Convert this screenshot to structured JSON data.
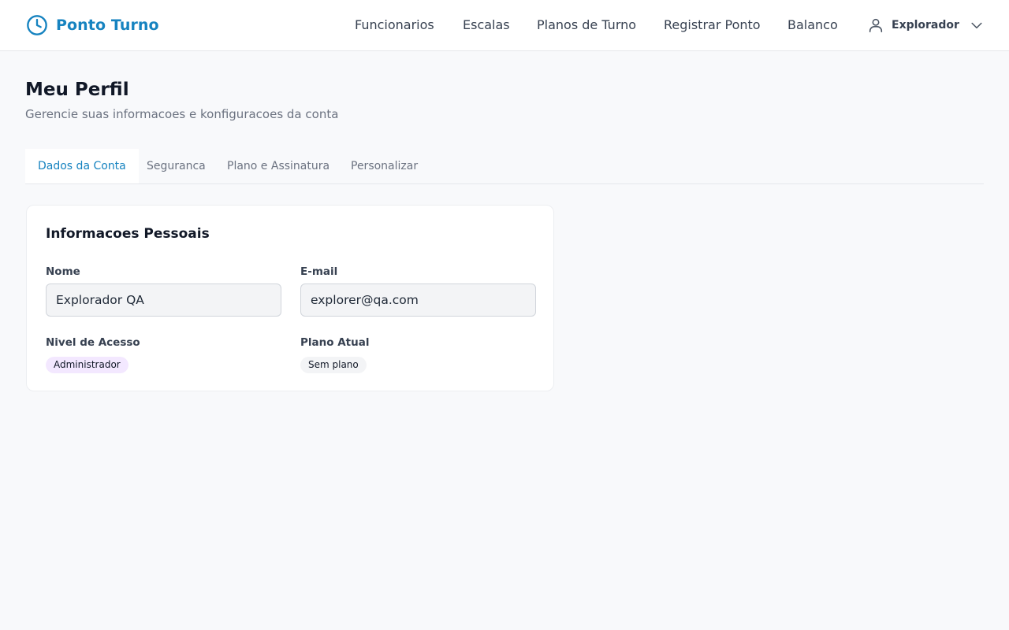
{
  "app": {
    "name": "Ponto Turno"
  },
  "nav": {
    "links": [
      "Funcionarios",
      "Escalas",
      "Planos de Turno",
      "Registrar Ponto",
      "Balanco"
    ],
    "user_name": "Explorador"
  },
  "page": {
    "title": "Meu Perfil",
    "subtitle": "Gerencie suas informacoes e konfiguracoes da conta"
  },
  "tabs": [
    {
      "label": "Dados da Conta",
      "active": true
    },
    {
      "label": "Seguranca",
      "active": false
    },
    {
      "label": "Plano e Assinatura",
      "active": false
    },
    {
      "label": "Personalizar",
      "active": false
    }
  ],
  "card": {
    "title": "Informacoes Pessoais",
    "name_label": "Nome",
    "name_value": "Explorador QA",
    "email_label": "E-mail",
    "email_value": "explorer@qa.com",
    "access_label": "Nivel de Acesso",
    "access_badge": "Administrador",
    "plan_label": "Plano Atual",
    "plan_badge": "Sem plano"
  },
  "colors": {
    "brand": "#1683c0",
    "background": "#f8f9fb",
    "admin_badge": "#f3e8ff",
    "plan_badge": "#f3f4f6"
  },
  "icons": {
    "logo": "clock-icon",
    "user": "user-icon",
    "menu": "chevron-down-icon"
  }
}
